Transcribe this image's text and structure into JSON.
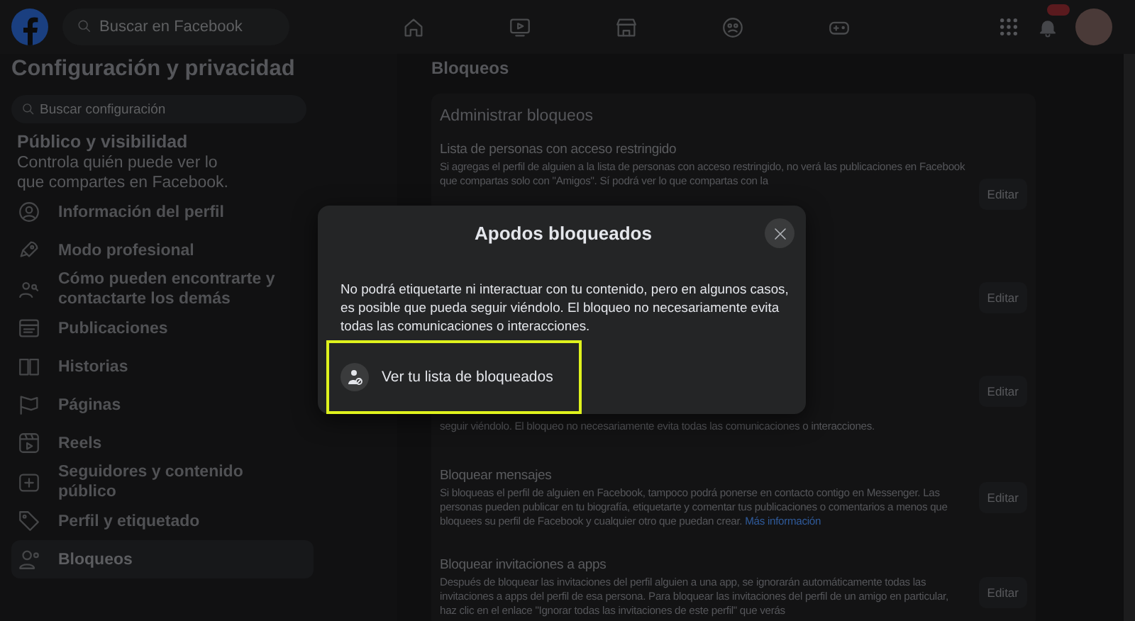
{
  "topbar": {
    "search": {
      "placeholder": "Buscar en Facebook"
    },
    "nav": [
      {
        "selected": false
      },
      {
        "selected": false
      },
      {
        "selected": false
      },
      {
        "selected": false
      },
      {
        "selected": false
      }
    ]
  },
  "sidebar": {
    "title": "Configuración y privacidad",
    "search": {
      "placeholder": "Buscar configuración"
    },
    "section_title": "Público y visibilidad",
    "section_description": "Controla quién puede ver lo que compartes en Facebook.",
    "items": [
      {
        "label": "Información del perfil",
        "selected": false
      },
      {
        "label": "Modo profesional",
        "selected": false
      },
      {
        "label": "Cómo pueden encontrarte y contactarte los demás",
        "selected": false
      },
      {
        "label": "Publicaciones",
        "selected": false
      },
      {
        "label": "Historias",
        "selected": false
      },
      {
        "label": "Páginas",
        "selected": false
      },
      {
        "label": "Reels",
        "selected": false
      },
      {
        "label": "Seguidores y contenido público",
        "selected": false
      },
      {
        "label": "Perfil y etiquetado",
        "selected": false
      },
      {
        "label": "Bloqueos",
        "selected": true
      }
    ]
  },
  "main": {
    "title": "Bloqueos",
    "card_title": "Administrar bloqueos",
    "sections": [
      {
        "title": "Lista de personas con acceso restringido",
        "description": "Si agregas el perfil de alguien a la lista de personas con acceso restringido, no verá las publicaciones en Facebook que compartas solo con \"Amigos\". Sí podrá ver lo que compartas con la",
        "button": "Editar"
      },
      {
        "button": "Editar"
      },
      {
        "description": "seguir viéndolo. El bloqueo no necesariamente evita todas las comunicaciones o interacciones.",
        "button": "Editar"
      },
      {
        "title": "Bloquear mensajes",
        "description": "Si bloqueas el perfil de alguien en Facebook, tampoco podrá ponerse en contacto contigo en Messenger. Las personas pueden publicar en tu biografía, etiquetarte y comentar tus publicaciones o comentarios a menos que bloquees su perfil de Facebook y cualquier otro que puedan crear.",
        "link": "Más información",
        "button": "Editar"
      },
      {
        "title": "Bloquear invitaciones a apps",
        "description": "Después de bloquear las invitaciones del perfil alguien a una app, se ignorarán automáticamente todas las invitaciones a apps del perfil de esa persona. Para bloquear las invitaciones del perfil de un amigo en particular, haz clic en el enlace \"Ignorar todas las invitaciones de este perfil\" que verás",
        "button": "Editar"
      }
    ]
  },
  "dialog": {
    "title": "Apodos bloqueados",
    "body": "No podrá etiquetarte ni interactuar con tu contenido, pero en algunos casos, es posible que pueda seguir viéndolo. El bloqueo no necesariamente evita todas las comunicaciones o interacciones.",
    "action": {
      "label": "Ver tu lista de bloqueados",
      "highlighted": true
    }
  }
}
